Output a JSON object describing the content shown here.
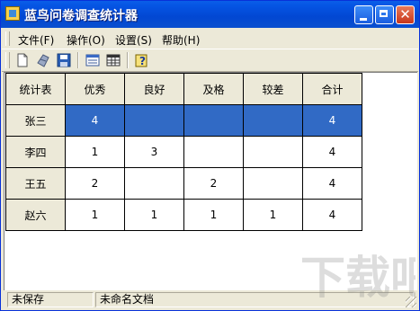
{
  "window": {
    "title": "蓝鸟问卷调查统计器"
  },
  "menu": [
    {
      "label": "文件(F)"
    },
    {
      "label": "操作(O)"
    },
    {
      "label": "设置(S)"
    },
    {
      "label": "帮助(H)"
    }
  ],
  "toolbar": {
    "items": [
      "new-file-icon",
      "open-file-icon",
      "save-icon",
      "view-form-icon",
      "view-table-icon",
      "help-icon"
    ]
  },
  "table": {
    "headers": [
      "统计表",
      "优秀",
      "良好",
      "及格",
      "较差",
      "合计"
    ],
    "rows": [
      {
        "name": "张三",
        "cells": [
          "4",
          "",
          "",
          "",
          "4"
        ]
      },
      {
        "name": "李四",
        "cells": [
          "1",
          "3",
          "",
          "",
          "4"
        ]
      },
      {
        "name": "王五",
        "cells": [
          "2",
          "",
          "2",
          "",
          "4"
        ]
      },
      {
        "name": "赵六",
        "cells": [
          "1",
          "1",
          "1",
          "1",
          "4"
        ]
      }
    ],
    "selected_row": 0,
    "selection_color": "#316ac5"
  },
  "status": {
    "save_state": "未保存",
    "document": "未命名文档"
  },
  "watermark": {
    "text": "下载吧"
  }
}
